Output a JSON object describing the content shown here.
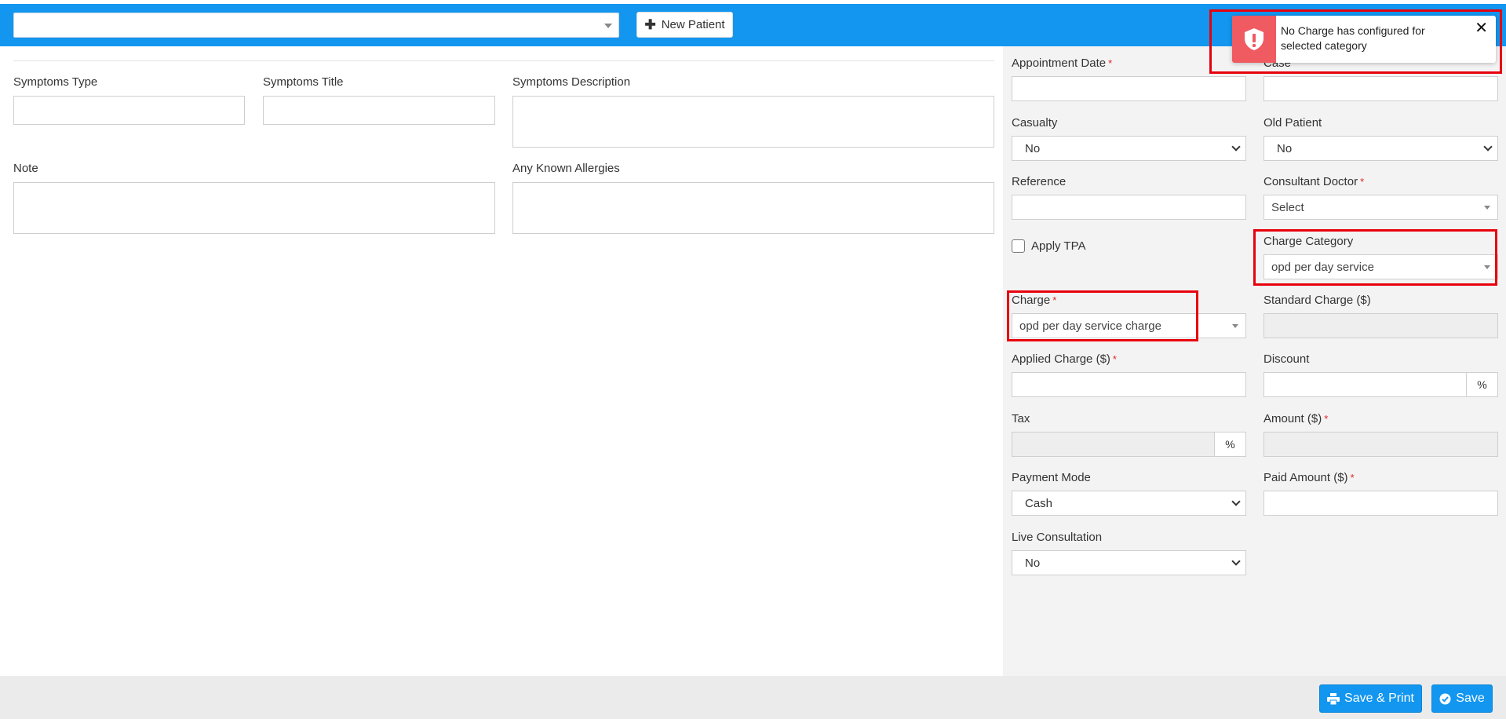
{
  "header": {
    "new_patient_label": "New Patient"
  },
  "left_form": {
    "symptoms_type_label": "Symptoms Type",
    "symptoms_title_label": "Symptoms Title",
    "symptoms_description_label": "Symptoms Description",
    "note_label": "Note",
    "allergies_label": "Any Known Allergies"
  },
  "right_form": {
    "appointment_date_label": "Appointment Date",
    "case_label": "Case",
    "casualty_label": "Casualty",
    "casualty_value": "No",
    "old_patient_label": "Old Patient",
    "old_patient_value": "No",
    "reference_label": "Reference",
    "consultant_doctor_label": "Consultant Doctor",
    "consultant_doctor_value": "Select",
    "apply_tpa_label": "Apply TPA",
    "charge_category_label": "Charge Category",
    "charge_category_value": "opd per day service",
    "charge_label": "Charge",
    "charge_value": "opd per day service charge",
    "standard_charge_label": "Standard Charge ($)",
    "applied_charge_label": "Applied Charge ($)",
    "discount_label": "Discount",
    "discount_suffix": "%",
    "tax_label": "Tax",
    "tax_suffix": "%",
    "amount_label": "Amount ($)",
    "payment_mode_label": "Payment Mode",
    "payment_mode_value": "Cash",
    "paid_amount_label": "Paid Amount ($)",
    "live_consultation_label": "Live Consultation",
    "live_consultation_value": "No",
    "required_marker": "*"
  },
  "toast": {
    "message": "No Charge has configured for selected category",
    "close_glyph": "✕"
  },
  "footer": {
    "save_print_label": "Save & Print",
    "save_label": "Save"
  },
  "colors": {
    "header_blue": "#1296f0",
    "error_red": "#f05a61",
    "highlight_red": "#e8000c"
  }
}
